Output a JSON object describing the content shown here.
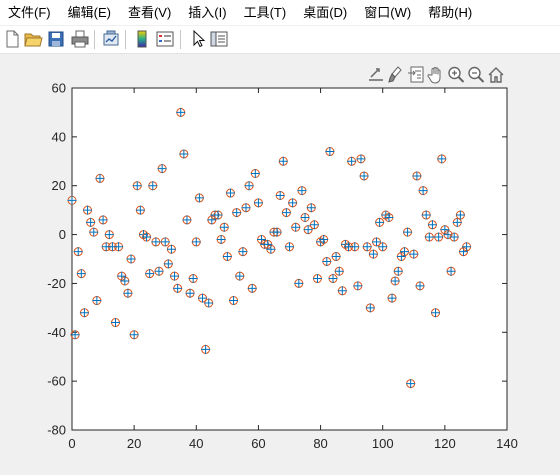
{
  "menubar": {
    "items": [
      {
        "label": "文件(F)",
        "name": "menu-file"
      },
      {
        "label": "编辑(E)",
        "name": "menu-edit"
      },
      {
        "label": "查看(V)",
        "name": "menu-view"
      },
      {
        "label": "插入(I)",
        "name": "menu-insert"
      },
      {
        "label": "工具(T)",
        "name": "menu-tools"
      },
      {
        "label": "桌面(D)",
        "name": "menu-desktop"
      },
      {
        "label": "窗口(W)",
        "name": "menu-window"
      },
      {
        "label": "帮助(H)",
        "name": "menu-help"
      }
    ]
  },
  "toolbar": {
    "buttons": [
      {
        "icon": "new-file-icon"
      },
      {
        "icon": "open-folder-icon"
      },
      {
        "icon": "save-icon"
      },
      {
        "icon": "print-icon"
      },
      {
        "icon": "link-plot-icon"
      },
      {
        "icon": "insert-colorbar-icon"
      },
      {
        "icon": "insert-legend-icon"
      },
      {
        "icon": "edit-plot-pointer-icon"
      },
      {
        "icon": "property-inspector-icon"
      }
    ]
  },
  "axes_toolbar": {
    "buttons": [
      {
        "icon": "export-icon"
      },
      {
        "icon": "brush-icon"
      },
      {
        "icon": "data-tips-icon"
      },
      {
        "icon": "pan-hand-icon"
      },
      {
        "icon": "zoom-in-icon"
      },
      {
        "icon": "zoom-out-icon"
      },
      {
        "icon": "home-icon"
      }
    ]
  },
  "chart_data": {
    "type": "scatter",
    "title": "",
    "xlabel": "",
    "ylabel": "",
    "xlim": [
      0,
      140
    ],
    "ylim": [
      -80,
      60
    ],
    "xticks": [
      0,
      20,
      40,
      60,
      80,
      100,
      120,
      140
    ],
    "yticks": [
      -80,
      -60,
      -40,
      -20,
      0,
      20,
      40,
      60
    ],
    "grid": false,
    "marker_colors": {
      "circle": "#d95319",
      "plus": "#0072bd"
    },
    "x": [
      0,
      1,
      2,
      3,
      4,
      5,
      6,
      7,
      8,
      9,
      10,
      11,
      12,
      13,
      14,
      15,
      16,
      17,
      18,
      19,
      20,
      21,
      22,
      23,
      24,
      25,
      26,
      27,
      28,
      29,
      30,
      31,
      32,
      33,
      34,
      35,
      36,
      37,
      38,
      39,
      40,
      41,
      42,
      43,
      44,
      45,
      46,
      47,
      48,
      49,
      50,
      51,
      52,
      53,
      54,
      55,
      56,
      57,
      58,
      59,
      60,
      61,
      62,
      63,
      64,
      65,
      66,
      67,
      68,
      69,
      70,
      71,
      72,
      73,
      74,
      75,
      76,
      77,
      78,
      79,
      80,
      81,
      82,
      83,
      84,
      85,
      86,
      87,
      88,
      89,
      90,
      91,
      92,
      93,
      94,
      95,
      96,
      97,
      98,
      99,
      100,
      101,
      102,
      103,
      104,
      105,
      106,
      107,
      108,
      109,
      110,
      111,
      112,
      113,
      114,
      115,
      116,
      117,
      118,
      119,
      120,
      121,
      122,
      123,
      124,
      125,
      126,
      127
    ],
    "y": [
      14,
      -41,
      -7,
      -16,
      -32,
      10,
      5,
      1,
      -27,
      23,
      6,
      -5,
      0,
      -5,
      -36,
      -5,
      -17,
      -19,
      -24,
      -10,
      -41,
      20,
      10,
      0,
      -1,
      -16,
      20,
      -3,
      -15,
      27,
      -3,
      -12,
      -6,
      -17,
      -22,
      50,
      33,
      6,
      -24,
      -18,
      -3,
      15,
      -26,
      -47,
      -28,
      6,
      8,
      8,
      -2,
      3,
      -9,
      17,
      -27,
      9,
      -17,
      -7,
      11,
      20,
      -22,
      25,
      13,
      -2,
      -4,
      -4,
      -6,
      1,
      1,
      16,
      30,
      9,
      -5,
      13,
      3,
      -20,
      18,
      7,
      2,
      11,
      4,
      -18,
      -3,
      -2,
      -11,
      34,
      -18,
      -9,
      -15,
      -23,
      -4,
      -5,
      30,
      -5,
      -21,
      31,
      24,
      -5,
      -30,
      -8,
      -3,
      5,
      -5,
      8,
      7,
      -26,
      -19,
      -15,
      -9,
      -7,
      1,
      -61,
      -8,
      24,
      -21,
      18,
      8,
      -1,
      4,
      -32,
      -1,
      31,
      2,
      0,
      -15,
      -1,
      5,
      8,
      -7,
      -5
    ]
  }
}
